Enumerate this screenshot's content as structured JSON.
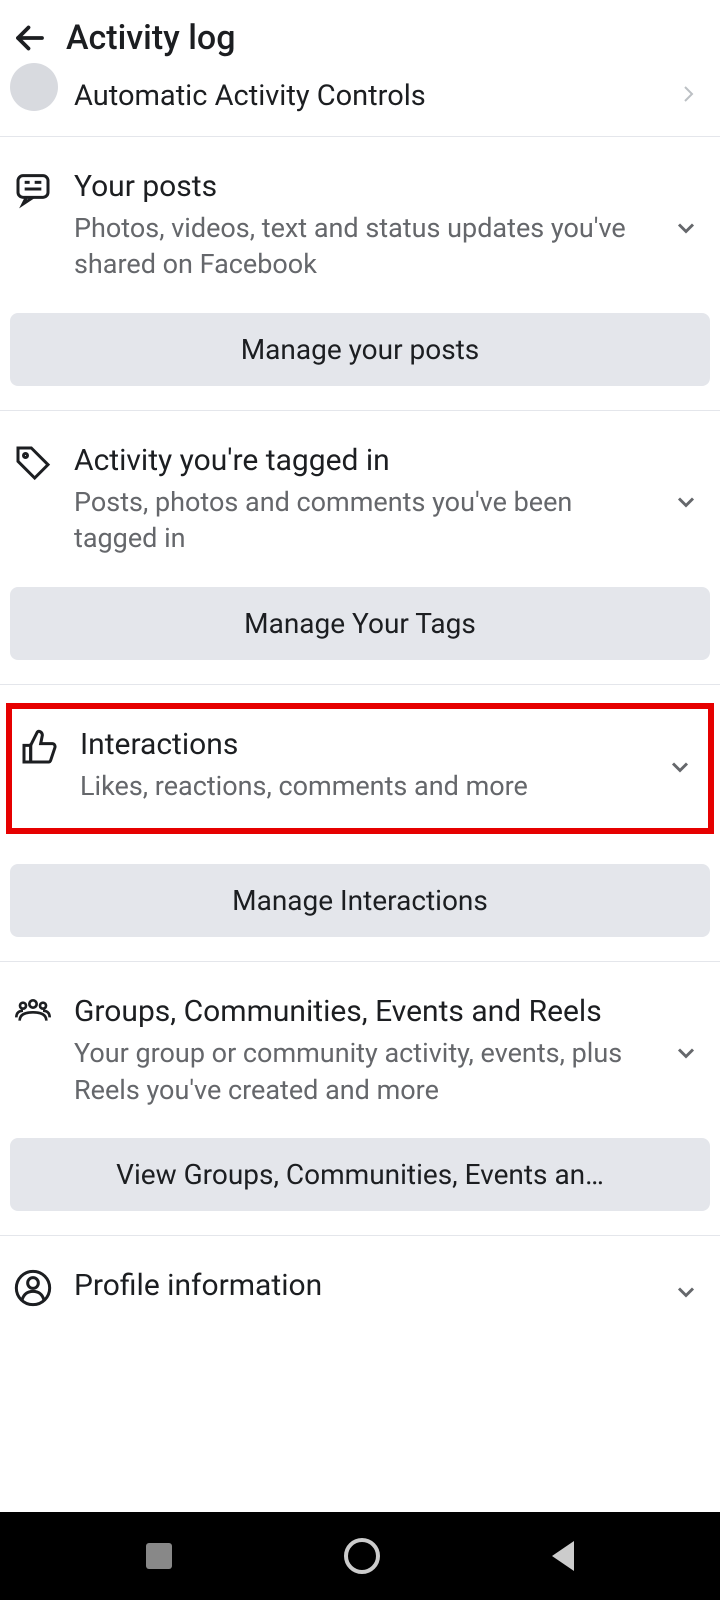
{
  "header": {
    "title": "Activity log"
  },
  "sections": {
    "automatic": {
      "title": "Automatic Activity Controls"
    },
    "posts": {
      "title": "Your posts",
      "subtitle": "Photos, videos, text and status updates you've shared on Facebook",
      "button": "Manage your posts"
    },
    "tagged": {
      "title": "Activity you're tagged in",
      "subtitle": "Posts, photos and comments you've been tagged in",
      "button": "Manage Your Tags"
    },
    "interactions": {
      "title": "Interactions",
      "subtitle": "Likes, reactions, comments and more",
      "button": "Manage Interactions"
    },
    "groups": {
      "title": "Groups, Communities, Events and Reels",
      "subtitle": "Your group or community activity, events, plus Reels you've created and more",
      "button": "View Groups, Communities, Events an…"
    },
    "profile": {
      "title": "Profile information"
    }
  }
}
